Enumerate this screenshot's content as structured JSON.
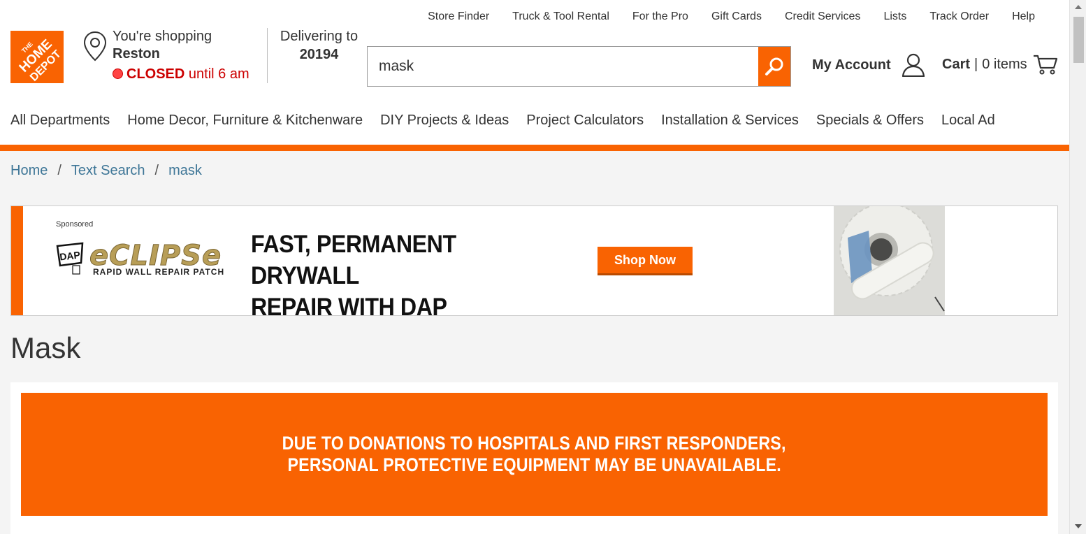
{
  "utility_links": [
    "Store Finder",
    "Truck & Tool Rental",
    "For the Pro",
    "Gift Cards",
    "Credit Services",
    "Lists",
    "Track Order",
    "Help"
  ],
  "logo": {
    "text": "THE HOME DEPOT",
    "color": "#f96302"
  },
  "store": {
    "line1": "You're shopping",
    "name": "Reston",
    "status": "CLOSED",
    "status_detail": "until 6 am",
    "status_color": "#cc0000"
  },
  "delivery": {
    "label": "Delivering to",
    "zip": "20194"
  },
  "search": {
    "value": "mask",
    "icon": "search-icon"
  },
  "account": {
    "label": "My Account",
    "icon": "user-icon"
  },
  "cart": {
    "label": "Cart",
    "separator": "|",
    "count_text": "0 items",
    "icon": "cart-icon"
  },
  "nav": [
    "All Departments",
    "Home Decor, Furniture & Kitchenware",
    "DIY Projects & Ideas",
    "Project Calculators",
    "Installation & Services",
    "Specials & Offers",
    "Local Ad"
  ],
  "breadcrumb": {
    "items": [
      "Home",
      "Text Search",
      "mask"
    ],
    "separator": "/"
  },
  "banner": {
    "sponsored": "Sponsored",
    "brand_badge": "DAP",
    "brand_name": "eCLIPSe",
    "brand_sub": "RAPID WALL REPAIR PATCH",
    "headline_1": "FAST, PERMANENT DRYWALL",
    "headline_2": "REPAIR WITH DAP",
    "cta": "Shop Now"
  },
  "page_title": "Mask",
  "notice": {
    "line1": "DUE TO DONATIONS TO HOSPITALS AND FIRST RESPONDERS,",
    "line2": "PERSONAL PROTECTIVE EQUIPMENT MAY BE UNAVAILABLE.",
    "color": "#f96302"
  },
  "colors": {
    "accent": "#f96302",
    "link": "#3e7697"
  }
}
